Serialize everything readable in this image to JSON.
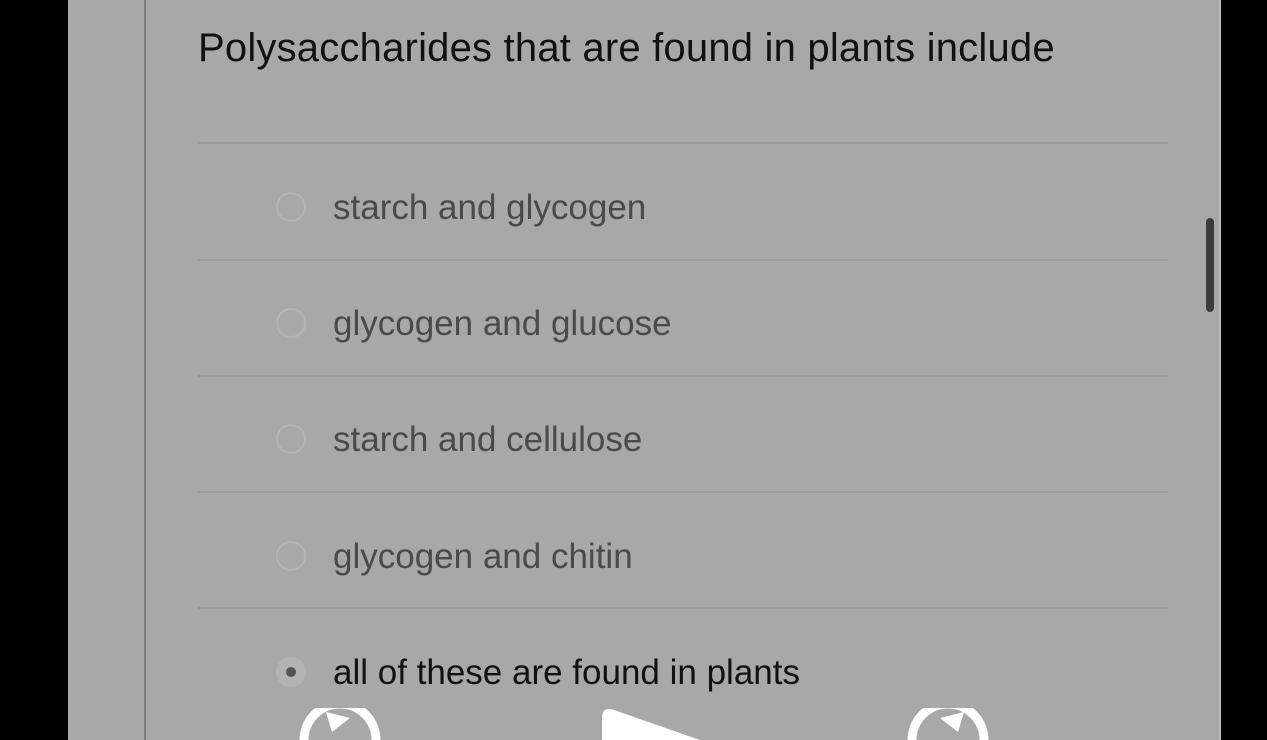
{
  "question": {
    "text": "Polysaccharides that are found in plants include"
  },
  "options": [
    {
      "label": "starch and glycogen",
      "selected": false
    },
    {
      "label": "glycogen and glucose",
      "selected": false
    },
    {
      "label": "starch and cellulose",
      "selected": false
    },
    {
      "label": "glycogen and chitin",
      "selected": false
    },
    {
      "label": "all of these are found in plants",
      "selected": true
    }
  ],
  "media_controls": {
    "rewind_icon": "replay-icon",
    "play_icon": "play-icon",
    "forward_icon": "forward-icon"
  },
  "colors": {
    "page_background": "#a8a8a8",
    "screen_background": "#000000",
    "question_text": "#111111",
    "unselected_option_text": "#4a4a4a"
  }
}
